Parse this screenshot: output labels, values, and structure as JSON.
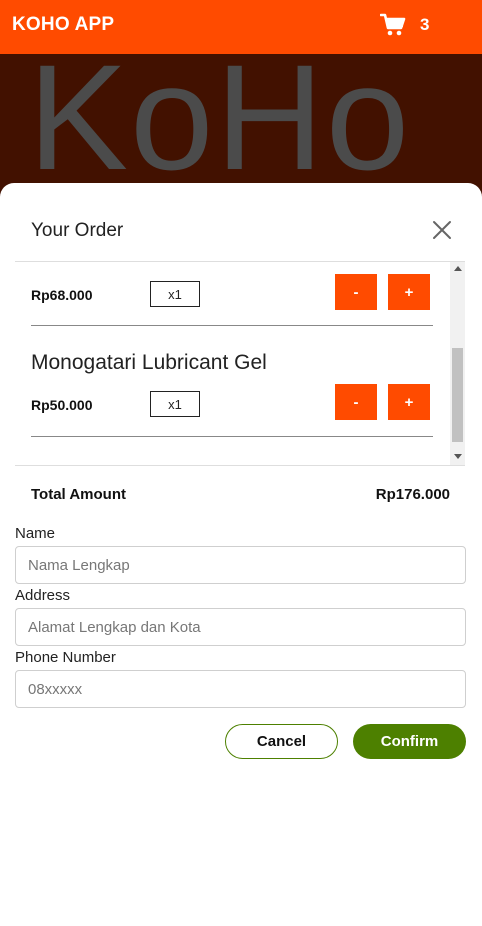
{
  "app": {
    "title": "KOHO APP",
    "cart_count": "3",
    "hero_text": "KoHo"
  },
  "modal": {
    "title": "Your Order",
    "items": [
      {
        "name": "",
        "price": "Rp68.000",
        "qty": "x1",
        "minus": "-",
        "plus": "+"
      },
      {
        "name": "Monogatari Lubricant Gel",
        "price": "Rp50.000",
        "qty": "x1",
        "minus": "-",
        "plus": "+"
      }
    ],
    "total_label": "Total Amount",
    "total_value": "Rp176.000"
  },
  "form": {
    "name_label": "Name",
    "name_placeholder": "Nama Lengkap",
    "address_label": "Address",
    "address_placeholder": "Alamat Lengkap dan Kota",
    "phone_label": "Phone Number",
    "phone_placeholder": "08xxxxx"
  },
  "actions": {
    "cancel": "Cancel",
    "confirm": "Confirm"
  },
  "colors": {
    "brand": "#ff4b00",
    "confirm": "#4d8000",
    "hero_bg": "#421100"
  },
  "icons": {
    "cart": "cart-icon",
    "close": "close-icon"
  }
}
